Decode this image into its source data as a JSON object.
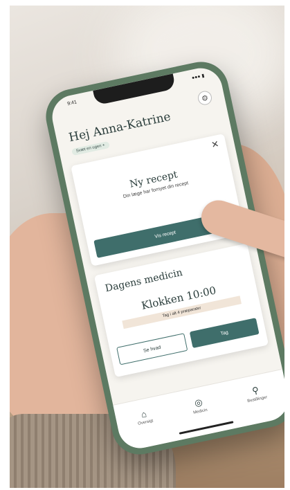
{
  "status": {
    "time": "9:41",
    "signal": "●●● ▮"
  },
  "header": {
    "greeting": "Hej Anna-Katrine",
    "chip": "Svæt en ugen +"
  },
  "card_recipe": {
    "title": "Ny recept",
    "subtitle": "Din læge har fornyet din recept",
    "button": "Vis recept",
    "close": "✕"
  },
  "card_med": {
    "title": "Dagens medicin",
    "time": "Klokken 10:00",
    "hint": "Tag i alt 4 præparater",
    "secondary_button": "Se hvad",
    "primary_button": "Tag"
  },
  "tabs": [
    {
      "label": "Oversigt",
      "icon": "home-icon"
    },
    {
      "label": "Medicin",
      "icon": "pill-icon"
    },
    {
      "label": "Bestillinger",
      "icon": "bag-icon"
    }
  ],
  "icons": {
    "settings": "gear-icon"
  }
}
